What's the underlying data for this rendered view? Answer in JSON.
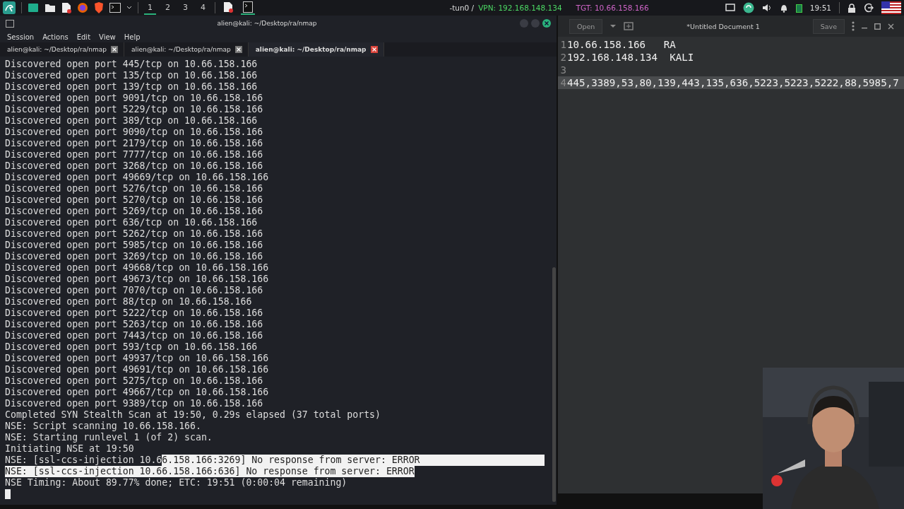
{
  "top_panel": {
    "workspaces": [
      {
        "label": "1",
        "selected": true
      },
      {
        "label": "2",
        "selected": false
      },
      {
        "label": "3",
        "selected": false
      },
      {
        "label": "4",
        "selected": false
      }
    ],
    "tasks": [
      {
        "kind": "document",
        "selected": false
      },
      {
        "kind": "terminal",
        "selected": true
      }
    ],
    "vpn_prefix": "-tun0 /",
    "vpn": "VPN: 192.168.148.134",
    "target": "TGT: 10.66.158.166",
    "clock": "19:51"
  },
  "terminal": {
    "title": "alien@kali: ~/Desktop/ra/nmap",
    "menu": [
      "Session",
      "Actions",
      "Edit",
      "View",
      "Help"
    ],
    "tabs": [
      {
        "label": "alien@kali: ~/Desktop/ra/nmap",
        "selected": false
      },
      {
        "label": "alien@kali: ~/Desktop/ra/nmap",
        "selected": false
      },
      {
        "label": "alien@kali: ~/Desktop/ra/nmap",
        "selected": true
      }
    ],
    "lines": [
      [
        {
          "text": "Discovered open port 445/tcp on 10.66.158.166",
          "selected": false
        }
      ],
      [
        {
          "text": "Discovered open port 135/tcp on 10.66.158.166",
          "selected": false
        }
      ],
      [
        {
          "text": "Discovered open port 139/tcp on 10.66.158.166",
          "selected": false
        }
      ],
      [
        {
          "text": "Discovered open port 9091/tcp on 10.66.158.166",
          "selected": false
        }
      ],
      [
        {
          "text": "Discovered open port 5229/tcp on 10.66.158.166",
          "selected": false
        }
      ],
      [
        {
          "text": "Discovered open port 389/tcp on 10.66.158.166",
          "selected": false
        }
      ],
      [
        {
          "text": "Discovered open port 9090/tcp on 10.66.158.166",
          "selected": false
        }
      ],
      [
        {
          "text": "Discovered open port 2179/tcp on 10.66.158.166",
          "selected": false
        }
      ],
      [
        {
          "text": "Discovered open port 7777/tcp on 10.66.158.166",
          "selected": false
        }
      ],
      [
        {
          "text": "Discovered open port 3268/tcp on 10.66.158.166",
          "selected": false
        }
      ],
      [
        {
          "text": "Discovered open port 49669/tcp on 10.66.158.166",
          "selected": false
        }
      ],
      [
        {
          "text": "Discovered open port 5276/tcp on 10.66.158.166",
          "selected": false
        }
      ],
      [
        {
          "text": "Discovered open port 5270/tcp on 10.66.158.166",
          "selected": false
        }
      ],
      [
        {
          "text": "Discovered open port 5269/tcp on 10.66.158.166",
          "selected": false
        }
      ],
      [
        {
          "text": "Discovered open port 636/tcp on 10.66.158.166",
          "selected": false
        }
      ],
      [
        {
          "text": "Discovered open port 5262/tcp on 10.66.158.166",
          "selected": false
        }
      ],
      [
        {
          "text": "Discovered open port 5985/tcp on 10.66.158.166",
          "selected": false
        }
      ],
      [
        {
          "text": "Discovered open port 3269/tcp on 10.66.158.166",
          "selected": false
        }
      ],
      [
        {
          "text": "Discovered open port 49668/tcp on 10.66.158.166",
          "selected": false
        }
      ],
      [
        {
          "text": "Discovered open port 49673/tcp on 10.66.158.166",
          "selected": false
        }
      ],
      [
        {
          "text": "Discovered open port 7070/tcp on 10.66.158.166",
          "selected": false
        }
      ],
      [
        {
          "text": "Discovered open port 88/tcp on 10.66.158.166",
          "selected": false
        }
      ],
      [
        {
          "text": "Discovered open port 5222/tcp on 10.66.158.166",
          "selected": false
        }
      ],
      [
        {
          "text": "Discovered open port 5263/tcp on 10.66.158.166",
          "selected": false
        }
      ],
      [
        {
          "text": "Discovered open port 7443/tcp on 10.66.158.166",
          "selected": false
        }
      ],
      [
        {
          "text": "Discovered open port 593/tcp on 10.66.158.166",
          "selected": false
        }
      ],
      [
        {
          "text": "Discovered open port 49937/tcp on 10.66.158.166",
          "selected": false
        }
      ],
      [
        {
          "text": "Discovered open port 49691/tcp on 10.66.158.166",
          "selected": false
        }
      ],
      [
        {
          "text": "Discovered open port 5275/tcp on 10.66.158.166",
          "selected": false
        }
      ],
      [
        {
          "text": "Discovered open port 49667/tcp on 10.66.158.166",
          "selected": false
        }
      ],
      [
        {
          "text": "Discovered open port 9389/tcp on 10.66.158.166",
          "selected": false
        }
      ],
      [
        {
          "text": "Completed SYN Stealth Scan at 19:50, 0.29s elapsed (37 total ports)",
          "selected": false
        }
      ],
      [
        {
          "text": "NSE: Script scanning 10.66.158.166.",
          "selected": false
        }
      ],
      [
        {
          "text": "NSE: Starting runlevel 1 (of 2) scan.",
          "selected": false
        }
      ],
      [
        {
          "text": "Initiating NSE at 19:50",
          "selected": false
        }
      ],
      [
        {
          "text": "NSE: [ssl-ccs-injection 10.6",
          "selected": false
        },
        {
          "text": "6.158.166:3269] No response from server: ERROR",
          "selected": true
        }
      ],
      [
        {
          "text": "NSE: [ssl-ccs-injection 10.66.158.166:636] No response from server: ERROR",
          "selected": true
        }
      ],
      [
        {
          "text": "NSE Timing: About 89.77% done; ETC: 19:51 (0:00:04 remaining)",
          "selected": false
        }
      ]
    ]
  },
  "editor": {
    "open": "Open",
    "title": "*Untitled Document 1",
    "save": "Save",
    "lines": [
      {
        "number": "1",
        "text": "10.66.158.166   RA",
        "current": false
      },
      {
        "number": "2",
        "text": "192.168.148.134  KALI",
        "current": false
      },
      {
        "number": "3",
        "current": false
      },
      {
        "number": "4",
        "text": "445,3389,53,80,139,443,135,636,5223,5223,5222,88,5985,7",
        "current": true
      }
    ]
  }
}
